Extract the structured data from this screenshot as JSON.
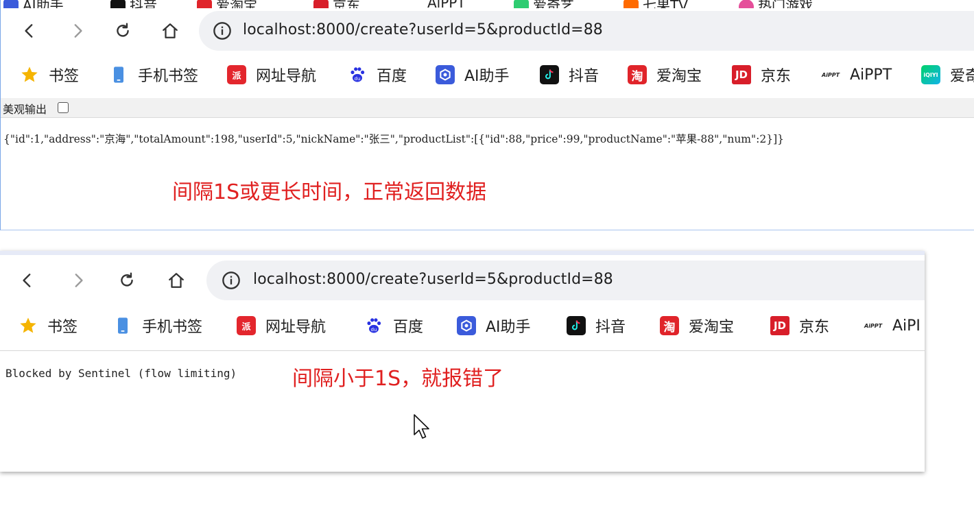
{
  "window_top": {
    "peek_items": [
      {
        "label": "AI助手",
        "icon": "ai-assistant-icon",
        "color": "#3b5bdb"
      },
      {
        "label": "抖音",
        "icon": "douyin-icon",
        "color": "#111111"
      },
      {
        "label": "爱淘宝",
        "icon": "taobao-icon",
        "color": "#e0242a"
      },
      {
        "label": "京东",
        "icon": "jd-icon",
        "color": "#d81e2a"
      },
      {
        "label": "AiPPT",
        "icon": "aippt-icon",
        "color": "#333333"
      },
      {
        "label": "爱奇艺",
        "icon": "iqiyi-icon",
        "color": "#2ecc71"
      },
      {
        "label": "七果TV",
        "icon": "tv-icon",
        "color": "#ff6a00"
      },
      {
        "label": "热门游戏",
        "icon": "game-icon",
        "color": "#e54f9a"
      }
    ],
    "url": "localhost:8000/create?userId=5&productId=88",
    "bookmarks": [
      {
        "label": "书签",
        "icon": "star-icon"
      },
      {
        "label": "手机书签",
        "icon": "phone-icon"
      },
      {
        "label": "网址导航",
        "icon": "nav-icon"
      },
      {
        "label": "百度",
        "icon": "baidu-icon"
      },
      {
        "label": "AI助手",
        "icon": "ai-assistant-icon"
      },
      {
        "label": "抖音",
        "icon": "douyin-icon"
      },
      {
        "label": "爱淘宝",
        "icon": "taobao-icon"
      },
      {
        "label": "京东",
        "icon": "jd-icon"
      },
      {
        "label": "AiPPT",
        "icon": "aippt-icon"
      },
      {
        "label": "爱奇",
        "icon": "iqiyi-icon"
      }
    ],
    "pretty_print_label": "美观输出",
    "json_body": "{\"id\":1,\"address\":\"京海\",\"totalAmount\":198,\"userId\":5,\"nickName\":\"张三\",\"productList\":[{\"id\":88,\"price\":99,\"productName\":\"苹果-88\",\"num\":2}]}",
    "annotation": "间隔1S或更长时间，正常返回数据"
  },
  "window_bottom": {
    "url": "localhost:8000/create?userId=5&productId=88",
    "bookmarks": [
      {
        "label": "书签",
        "icon": "star-icon"
      },
      {
        "label": "手机书签",
        "icon": "phone-icon"
      },
      {
        "label": "网址导航",
        "icon": "nav-icon"
      },
      {
        "label": "百度",
        "icon": "baidu-icon"
      },
      {
        "label": "AI助手",
        "icon": "ai-assistant-icon"
      },
      {
        "label": "抖音",
        "icon": "douyin-icon"
      },
      {
        "label": "爱淘宝",
        "icon": "taobao-icon"
      },
      {
        "label": "京东",
        "icon": "jd-icon"
      },
      {
        "label": "AiPI",
        "icon": "aippt-icon"
      }
    ],
    "body_text": "Blocked by Sentinel (flow limiting)",
    "annotation": "间隔小于1S，就报错了"
  },
  "colors": {
    "annotation": "#e02020",
    "omnibox": "#f0f1f4",
    "star": "#f5b400",
    "baidu": "#2932e1",
    "jd": "#d81e2a",
    "taobao": "#e0242a"
  }
}
